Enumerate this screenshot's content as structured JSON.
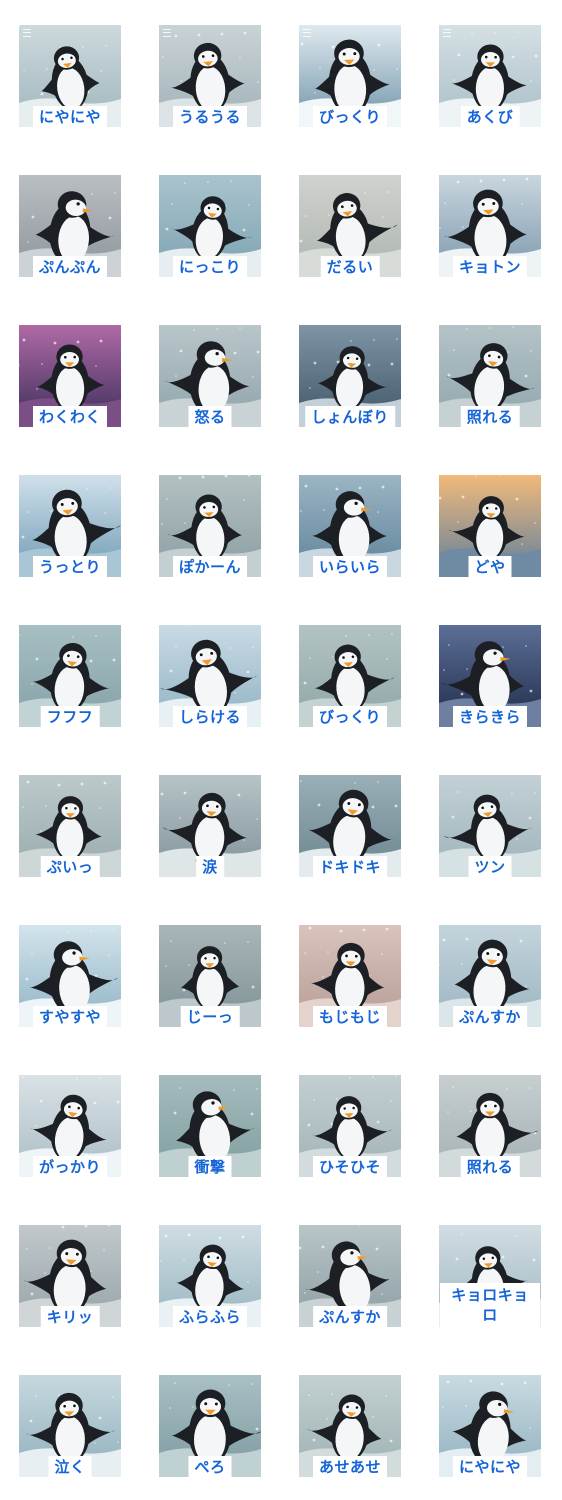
{
  "stickers": [
    {
      "label": "にやにや",
      "bg": [
        "#cdd9dc",
        "#9fb6bd"
      ],
      "ground": "#e7eef0",
      "menu": true
    },
    {
      "label": "うるうる",
      "bg": [
        "#c9d3d7",
        "#a1b1b7"
      ],
      "ground": "#dbe3e6",
      "menu": true
    },
    {
      "label": "びっくり",
      "bg": [
        "#dfe9ef",
        "#6f93a8"
      ],
      "ground": "#f1f6f8",
      "menu": true
    },
    {
      "label": "あくび",
      "bg": [
        "#d5e0e4",
        "#a8bec6"
      ],
      "ground": "#eef3f5",
      "menu": true
    },
    {
      "label": "ぷんぷん",
      "bg": [
        "#b9bec2",
        "#8d959b"
      ],
      "ground": "#ccd2d6"
    },
    {
      "label": "にっこり",
      "bg": [
        "#a9c3cd",
        "#7da2b1"
      ],
      "ground": "#e6eef1"
    },
    {
      "label": "だるい",
      "bg": [
        "#cfd3cf",
        "#aeb4ae"
      ],
      "ground": "#d8dcd8"
    },
    {
      "label": "キョトン",
      "bg": [
        "#c9d6df",
        "#7b97ab"
      ],
      "ground": "#eef3f6"
    },
    {
      "label": "わくわく",
      "bg": [
        "#b06aa6",
        "#3a2e5a"
      ],
      "ground": "#7a4f86"
    },
    {
      "label": "怒る",
      "bg": [
        "#b9c6ca",
        "#8ea3aa"
      ],
      "ground": "#c9d3d6"
    },
    {
      "label": "しょんぼり",
      "bg": [
        "#7f95a6",
        "#3f5668"
      ],
      "ground": "#c3d0d8"
    },
    {
      "label": "照れる",
      "bg": [
        "#b4c3c7",
        "#8fa5ab"
      ],
      "ground": "#c6d1d4"
    },
    {
      "label": "うっとり",
      "bg": [
        "#d0e0ea",
        "#6f9ab4"
      ],
      "ground": "#a9c6d6"
    },
    {
      "label": "ぽかーん",
      "bg": [
        "#b3c0c2",
        "#8a9ea2"
      ],
      "ground": "#c4cfd1"
    },
    {
      "label": "いらいら",
      "bg": [
        "#9bb5c4",
        "#5f8299"
      ],
      "ground": "#c9d8e0"
    },
    {
      "label": "どや",
      "bg": [
        "#f2b97a",
        "#5e7f9d"
      ],
      "ground": "#6f8aa3"
    },
    {
      "label": "フフフ",
      "bg": [
        "#a7bfc3",
        "#83a1a7"
      ],
      "ground": "#c2d3d6"
    },
    {
      "label": "しらける",
      "bg": [
        "#c9dbe4",
        "#8fb1c3"
      ],
      "ground": "#e7f0f4"
    },
    {
      "label": "びっくり",
      "bg": [
        "#b3c3c3",
        "#8fa5a6"
      ],
      "ground": "#c5d2d2"
    },
    {
      "label": "きらきら",
      "bg": [
        "#5c6f96",
        "#1f2b4a"
      ],
      "ground": "#6e7fa2"
    },
    {
      "label": "ぷいっ",
      "bg": [
        "#bcc9cb",
        "#98abae"
      ],
      "ground": "#cdd7d8"
    },
    {
      "label": "涙",
      "bg": [
        "#b7c3c7",
        "#7f939a"
      ],
      "ground": "#dfe6e8"
    },
    {
      "label": "ドキドキ",
      "bg": [
        "#9aafb7",
        "#6a848f"
      ],
      "ground": "#e3ebee"
    },
    {
      "label": "ツン",
      "bg": [
        "#c3d1d6",
        "#9cb2b9"
      ],
      "ground": "#d6e1e4"
    },
    {
      "label": "すやすや",
      "bg": [
        "#d3e4ec",
        "#8fb2c3"
      ],
      "ground": "#eef5f8"
    },
    {
      "label": "じーっ",
      "bg": [
        "#a9b6b9",
        "#7e9195"
      ],
      "ground": "#bcc8cb"
    },
    {
      "label": "もじもじ",
      "bg": [
        "#d9c3bc",
        "#b69c96"
      ],
      "ground": "#e4d2cc"
    },
    {
      "label": "ぷんすか",
      "bg": [
        "#c4d4dc",
        "#9ab4c1"
      ],
      "ground": "#dbe6eb"
    },
    {
      "label": "がっかり",
      "bg": [
        "#d9e2e6",
        "#aabcc4"
      ],
      "ground": "#eff4f6"
    },
    {
      "label": "衝撃",
      "bg": [
        "#a5bcbd",
        "#7f9d9e"
      ],
      "ground": "#bfd0d1"
    },
    {
      "label": "ひそひそ",
      "bg": [
        "#c3cfd2",
        "#a0b2b6"
      ],
      "ground": "#d2dcde"
    },
    {
      "label": "照れる",
      "bg": [
        "#c6ced0",
        "#a4b0b3"
      ],
      "ground": "#d3dadc"
    },
    {
      "label": "キリッ",
      "bg": [
        "#c1c8cb",
        "#96a3a8"
      ],
      "ground": "#d0d6d8"
    },
    {
      "label": "ふらふら",
      "bg": [
        "#cfdde3",
        "#97b4c0"
      ],
      "ground": "#e9f1f4"
    },
    {
      "label": "ぷんすか",
      "bg": [
        "#b9c5c8",
        "#8b9da2"
      ],
      "ground": "#c8d2d4"
    },
    {
      "label": "キョロキョロ",
      "bg": [
        "#d1dde3",
        "#9fb6c1"
      ],
      "ground": "#e6eef2",
      "wrap": true
    },
    {
      "label": "泣く",
      "bg": [
        "#c7d8df",
        "#8fb0bd"
      ],
      "ground": "#e7eff2"
    },
    {
      "label": "ぺろ",
      "bg": [
        "#a9c0c4",
        "#7c9aa0"
      ],
      "ground": "#c0d1d4"
    },
    {
      "label": "あせあせ",
      "bg": [
        "#c3d0d1",
        "#9db1b3"
      ],
      "ground": "#d2dcdd"
    },
    {
      "label": "にやにや",
      "bg": [
        "#c9dbe2",
        "#90b0be"
      ],
      "ground": "#e4edf1"
    }
  ]
}
